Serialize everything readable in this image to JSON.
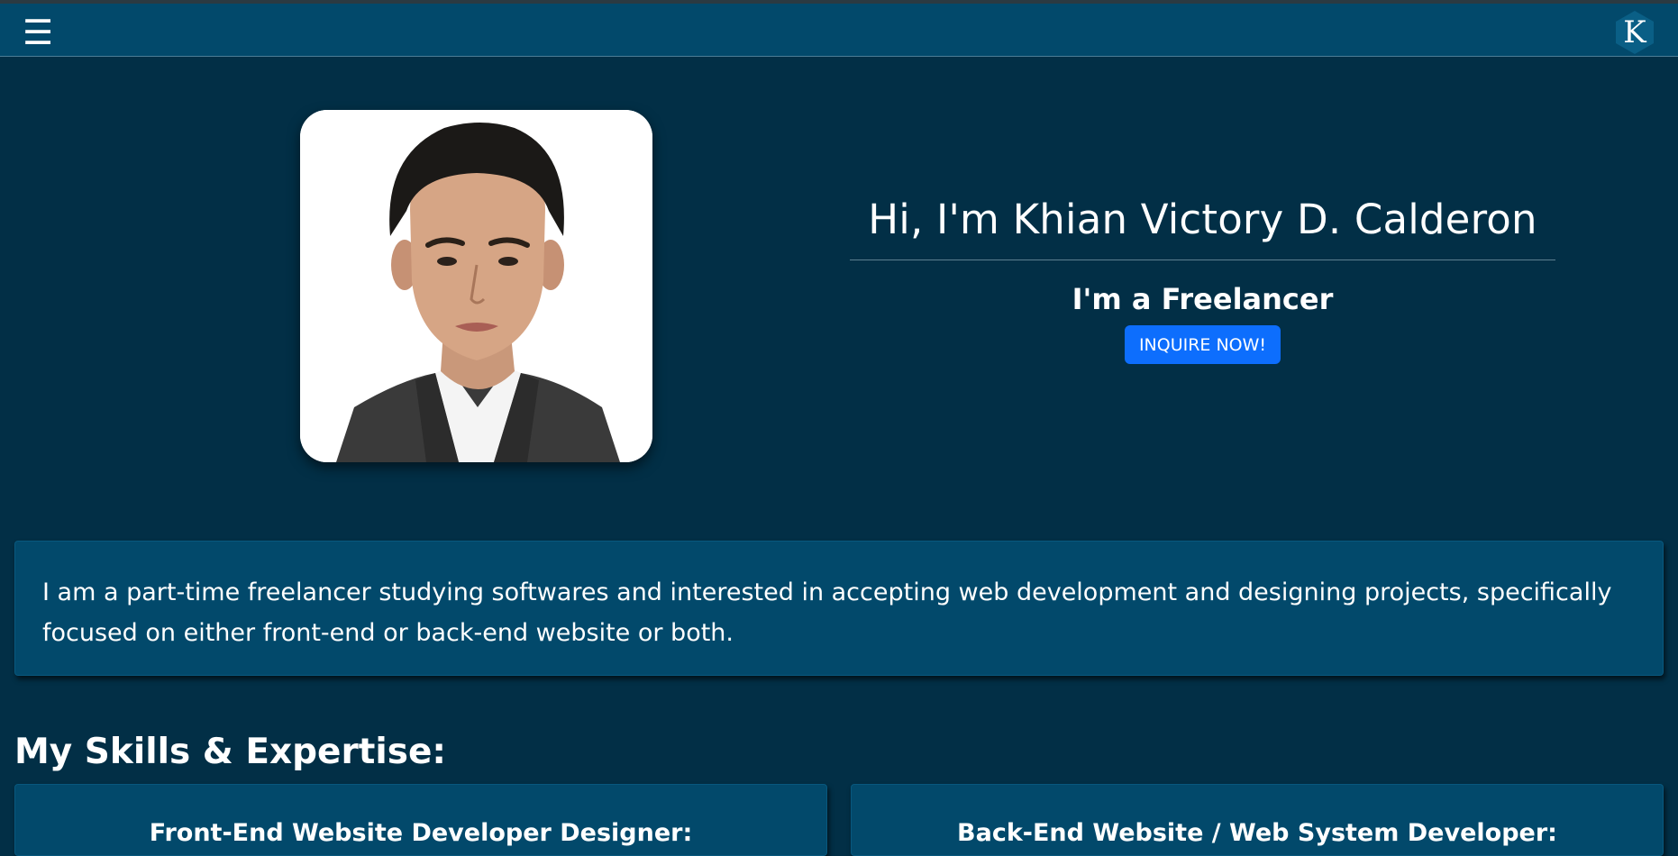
{
  "navbar": {
    "menu_icon": "hamburger-menu-icon",
    "menu_glyph": "☰",
    "logo_letter": "K",
    "logo_icon": "hexagon-logo-icon"
  },
  "hero": {
    "title": "Hi, I'm Khian Victory D. Calderon",
    "subtitle": "I'm a Freelancer",
    "cta_label": "INQUIRE NOW!"
  },
  "about": {
    "text": "I am a part-time freelancer studying softwares and interested in accepting web development and designing projects, specifically focused on either front-end or back-end website or both."
  },
  "skills": {
    "heading": "My Skills & Expertise:",
    "cards": [
      {
        "title": "Front-End Website Developer Designer:"
      },
      {
        "title": "Back-End Website / Web System Developer:"
      }
    ]
  },
  "colors": {
    "page_bg": "#022f46",
    "navbar_bg": "#02496b",
    "card_bg": "#02496b",
    "accent_button": "#0d6efd",
    "logo_hex": "#0a5f86"
  }
}
